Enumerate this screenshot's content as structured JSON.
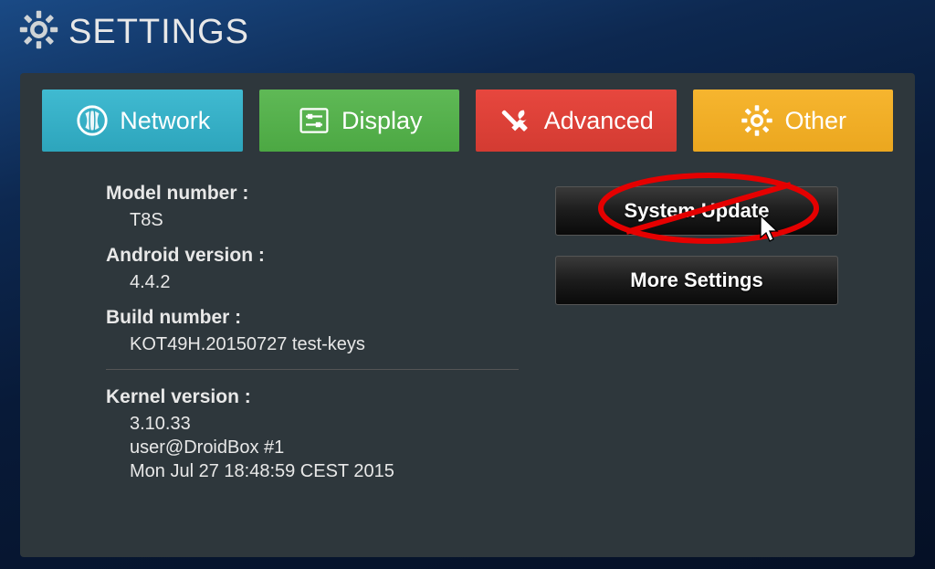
{
  "header": {
    "title": "SETTINGS"
  },
  "tabs": {
    "network": "Network",
    "display": "Display",
    "advanced": "Advanced",
    "other": "Other"
  },
  "info": {
    "model_label": "Model number :",
    "model_value": "T8S",
    "android_label": "Android version :",
    "android_value": "4.4.2",
    "build_label": "Build number :",
    "build_value": "KOT49H.20150727 test-keys",
    "kernel_label": "Kernel version :",
    "kernel_value": "3.10.33\nuser@DroidBox #1\nMon Jul 27 18:48:59 CEST 2015"
  },
  "buttons": {
    "system_update": "System Update",
    "more_settings": "More Settings"
  },
  "colors": {
    "tab_network": "#2da5bc",
    "tab_display": "#4ca843",
    "tab_advanced": "#d33b32",
    "tab_other": "#eba71f",
    "annotation_red": "#e50000"
  }
}
